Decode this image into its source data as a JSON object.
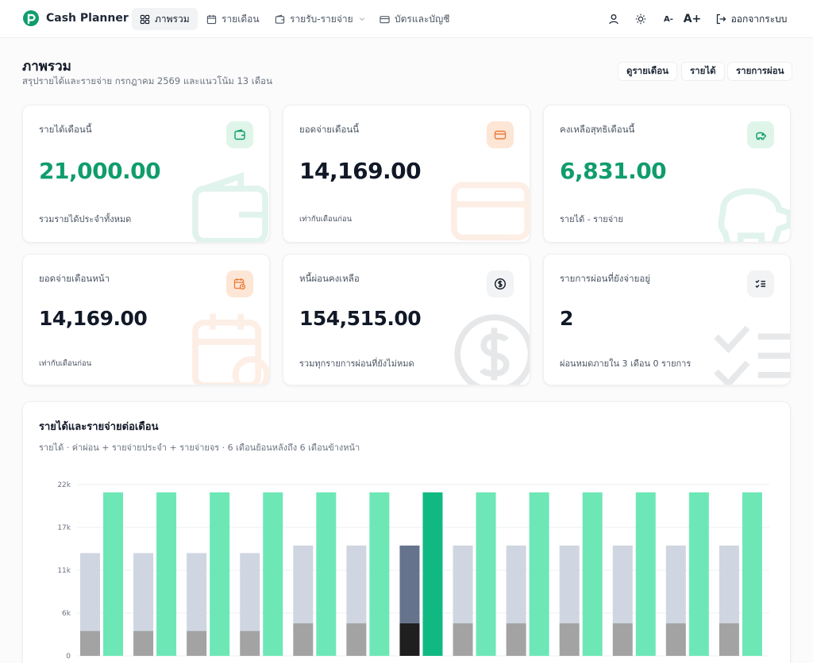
{
  "app": {
    "name": "Cash Planner",
    "brand_color": "#0f9d6b"
  },
  "nav": {
    "items": [
      {
        "label": "ภาพรวม",
        "icon": "dashboard-icon",
        "active": true
      },
      {
        "label": "รายเดือน",
        "icon": "calendar-icon",
        "active": false
      },
      {
        "label": "รายรับ-รายจ่าย",
        "icon": "wallet-icon",
        "active": false
      },
      {
        "label": "บัตรและบัญชี",
        "icon": "card-icon",
        "active": false
      }
    ],
    "font_smaller": "A-",
    "font_larger": "A+",
    "logout_label": "ออกจากระบบ"
  },
  "header": {
    "title": "ภาพรวม",
    "subtitle": "สรุปรายได้และรายจ่าย กรกฎาคม 2569 และแนวโน้ม 13 เดือน",
    "buttons": [
      "ดูรายเดือน",
      "รายได้",
      "รายการผ่อน"
    ]
  },
  "cards": [
    {
      "label": "รายได้เดือนนี้",
      "value": "21,000.00",
      "foot": "รวมรายได้ประจำทั้งหมด",
      "icon": "wallet-icon",
      "accent": "#0f9d6b"
    },
    {
      "label": "ยอดจ่ายเดือนนี้",
      "value": "14,169.00",
      "foot": "เท่ากับเดือนก่อน",
      "icon": "credit-card-icon",
      "accent": "#ea7b35"
    },
    {
      "label": "คงเหลือสุทธิเดือนนี้",
      "value": "6,831.00",
      "foot": "รายได้ - รายจ่าย",
      "icon": "piggy-bank-icon",
      "accent": "#0f9d6b"
    },
    {
      "label": "ยอดจ่ายเดือนหน้า",
      "value": "14,169.00",
      "foot": "เท่ากับเดือนก่อน",
      "icon": "calendar-clock-icon",
      "accent": "#ea7b35"
    },
    {
      "label": "หนี้ผ่อนคงเหลือ",
      "value": "154,515.00",
      "foot": "รวมทุกรายการผ่อนที่ยังไม่หมด",
      "icon": "dollar-circle-icon",
      "accent": "#374151"
    },
    {
      "label": "รายการผ่อนที่ยังจ่ายอยู่",
      "value": "2",
      "foot": "ผ่อนหมดภายใน 3 เดือน 0 รายการ",
      "icon": "checklist-icon",
      "accent": "#374151"
    }
  ],
  "chart": {
    "title": "รายได้และรายจ่ายต่อเดือน",
    "subtitle": "รายได้ · ค่าผ่อน + รายจ่ายประจำ + รายจ่ายจร · 6 เดือนย้อนหลังถึง 6 เดือนข้างหน้า"
  },
  "chart_data": {
    "type": "bar",
    "stacked_expenses": true,
    "y_ticks": [
      "0",
      "6k",
      "11k",
      "17k",
      "22k"
    ],
    "ylim": [
      0,
      22000
    ],
    "current_month_index": 6,
    "months": [
      {
        "installment": 3200,
        "other": 10000,
        "income": 21000
      },
      {
        "installment": 3200,
        "other": 10000,
        "income": 21000
      },
      {
        "installment": 3200,
        "other": 10000,
        "income": 21000
      },
      {
        "installment": 3200,
        "other": 10000,
        "income": 21000
      },
      {
        "installment": 4200,
        "other": 9969,
        "income": 21000
      },
      {
        "installment": 4200,
        "other": 9969,
        "income": 21000
      },
      {
        "installment": 4200,
        "other": 9969,
        "income": 21000
      },
      {
        "installment": 4200,
        "other": 9969,
        "income": 21000
      },
      {
        "installment": 4200,
        "other": 9969,
        "income": 21000
      },
      {
        "installment": 4200,
        "other": 9969,
        "income": 21000
      },
      {
        "installment": 4200,
        "other": 9969,
        "income": 21000
      },
      {
        "installment": 4200,
        "other": 9969,
        "income": 21000
      },
      {
        "installment": 4200,
        "other": 9969,
        "income": 21000
      }
    ],
    "colors": {
      "installment": "#a3a3a3",
      "other": "#cfd6e1",
      "income": "#6ee7b7",
      "installment_current": "#1f1f1f",
      "other_current": "#66738c",
      "income_current": "#10b981"
    }
  }
}
